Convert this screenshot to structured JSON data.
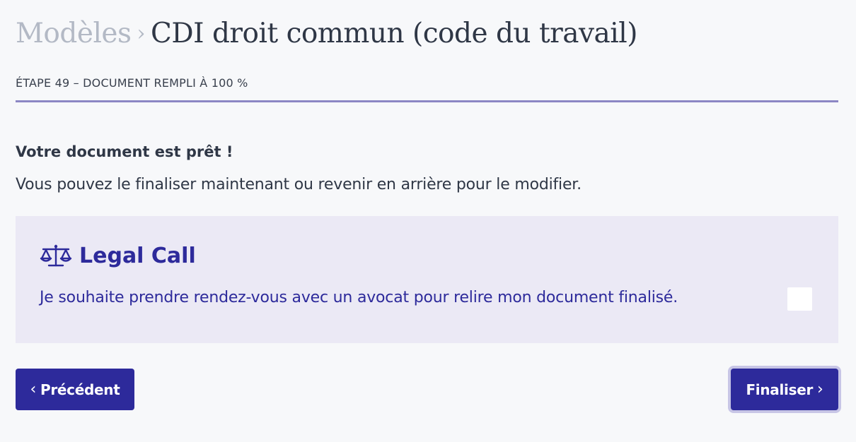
{
  "breadcrumb": {
    "parent": "Modèles",
    "separator": "›",
    "current": "CDI droit commun (code du travail)"
  },
  "step": {
    "label": "ÉTAPE 49 – DOCUMENT REMPLI À 100 %"
  },
  "ready": {
    "title": "Votre document est prêt !",
    "subtitle": "Vous pouvez le finaliser maintenant ou revenir en arrière pour le modifier."
  },
  "legal_call": {
    "icon": "scale-icon",
    "title": "Legal Call",
    "text": "Je souhaite prendre rendez-vous avec un avocat pour relire mon document finalisé.",
    "checked": false
  },
  "nav": {
    "prev_icon": "‹",
    "prev_label": "Précédent",
    "next_label": "Finaliser",
    "next_icon": "›"
  },
  "colors": {
    "accent": "#2d2a9b",
    "panel_bg": "#ebe9f5",
    "rule": "#8c87c4",
    "text": "#2f3746",
    "muted": "#b3b9c5"
  }
}
